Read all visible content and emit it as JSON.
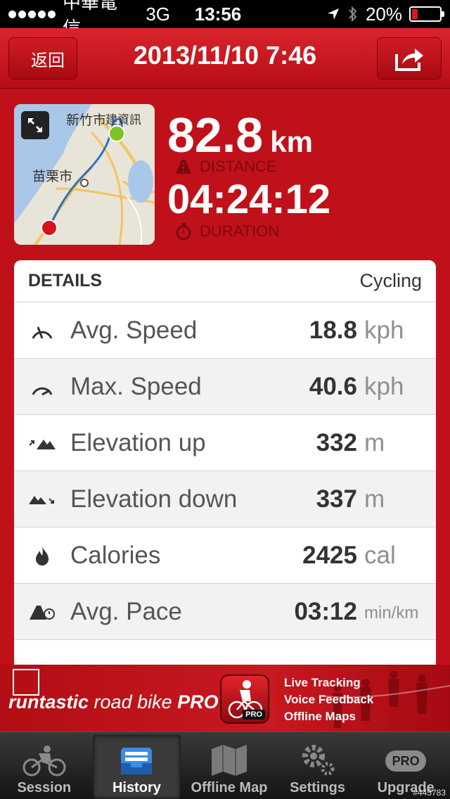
{
  "status_bar": {
    "carrier": "中華電信",
    "network": "3G",
    "time": "13:56",
    "battery": "20%",
    "battery_level": 0.2
  },
  "nav": {
    "back_label": "返回",
    "title": "2013/11/10 7:46"
  },
  "map": {
    "label_top": "新竹市",
    "label_top2": "建資訊",
    "label_left": "苗栗市"
  },
  "summary": {
    "distance_value": "82.8",
    "distance_unit": "km",
    "distance_label": "DISTANCE",
    "duration_value": "04:24:12",
    "duration_label": "DURATION"
  },
  "details": {
    "title": "DETAILS",
    "activity": "Cycling",
    "rows": [
      {
        "label": "Avg. Speed",
        "value": "18.8",
        "unit": "kph",
        "icon": "speedometer-icon"
      },
      {
        "label": "Max. Speed",
        "value": "40.6",
        "unit": "kph",
        "icon": "max-speedometer-icon"
      },
      {
        "label": "Elevation up",
        "value": "332",
        "unit": "m",
        "icon": "elevation-up-icon"
      },
      {
        "label": "Elevation down",
        "value": "337",
        "unit": "m",
        "icon": "elevation-down-icon"
      },
      {
        "label": "Calories",
        "value": "2425",
        "unit": "cal",
        "icon": "flame-icon"
      },
      {
        "label": "Avg. Pace",
        "value": "03:12",
        "unit": "min/km",
        "icon": "pace-icon"
      }
    ]
  },
  "banner": {
    "brand_runtastic": "runtastic",
    "brand_product": "road bike",
    "brand_pro": "PRO",
    "badge": "PRO",
    "features": [
      "Live Tracking",
      "Voice Feedback",
      "Offline Maps"
    ]
  },
  "tabs": [
    {
      "label": "Session",
      "icon": "cyclist-icon"
    },
    {
      "label": "History",
      "icon": "tray-icon",
      "active": true
    },
    {
      "label": "Offline Map",
      "icon": "map-icon"
    },
    {
      "label": "Settings",
      "icon": "gear-icon"
    },
    {
      "label": "Upgrade",
      "icon": "pro-badge-icon",
      "badge": "PRO"
    }
  ],
  "watermark": "#445783",
  "colors": {
    "brand_red": "#c0111b",
    "accent_red": "#e0161d"
  }
}
